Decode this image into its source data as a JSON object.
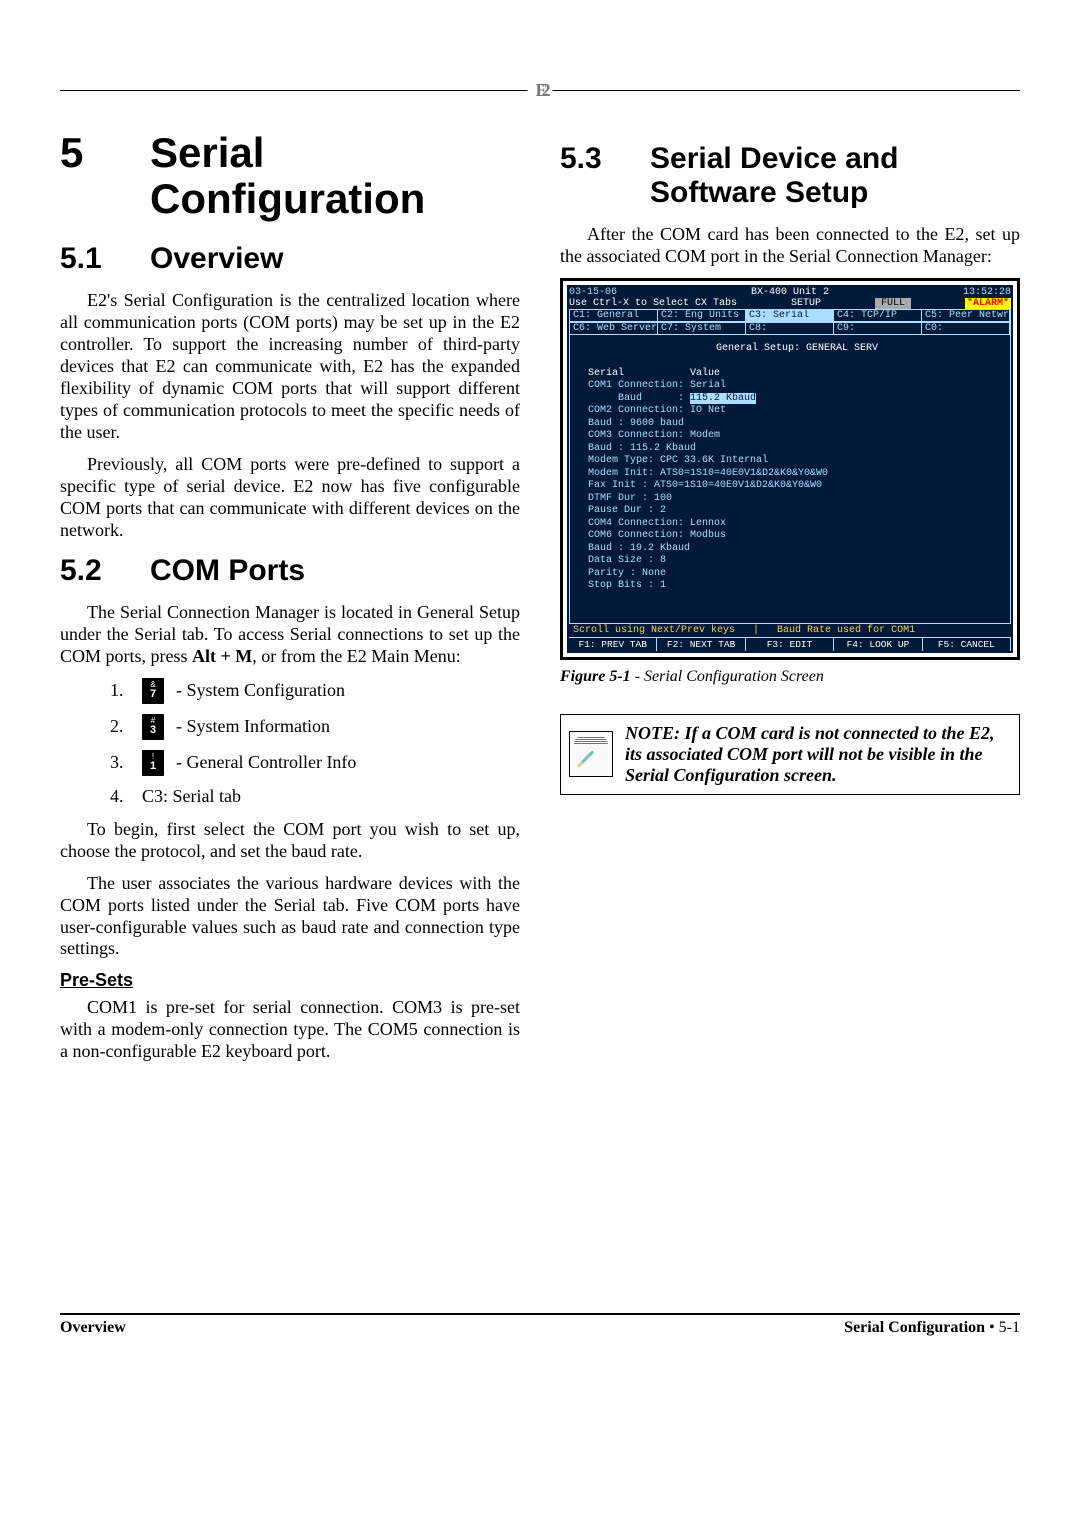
{
  "logo_text": "E2",
  "left": {
    "chapter": {
      "num": "5",
      "title": "Serial Configuration"
    },
    "s1": {
      "num": "5.1",
      "title": "Overview",
      "p1": "E2's Serial Configuration is the centralized location where all communication ports (COM ports) may be set up in the E2 controller. To support the increasing number of third-party devices that E2 can communicate with, E2 has the expanded flexibility of dynamic COM ports that will support different types of communication protocols to meet the specific needs of the user.",
      "p2": "Previously, all COM ports were pre-defined to support a specific type of serial device. E2 now has five configurable COM ports that can communicate with different devices on the network."
    },
    "s2": {
      "num": "5.2",
      "title": "COM Ports",
      "p1_a": "The Serial Connection Manager is located in General Setup under the Serial tab. To access Serial connections to set up the COM ports, press ",
      "p1_b": "Alt + M",
      "p1_c": ", or from the E2 Main Menu:",
      "steps": [
        {
          "n": "1.",
          "key_top": "&",
          "key_bot": "7",
          "label": " - System Configuration"
        },
        {
          "n": "2.",
          "key_top": "#",
          "key_bot": "3",
          "label": " - System Information"
        },
        {
          "n": "3.",
          "key_top": "!",
          "key_bot": "1",
          "label": " - General Controller Info"
        },
        {
          "n": "4.",
          "label": "C3: Serial tab"
        }
      ],
      "p2": "To begin, first select the COM port you wish to set up, choose the protocol, and set the baud rate.",
      "p3": "The user associates the various hardware devices with the COM ports listed under the Serial tab. Five COM ports have user-configurable values such as baud rate and connection type settings.",
      "presets_h": "Pre-Sets",
      "p4": "COM1 is pre-set for serial connection. COM3 is pre-set with a modem-only connection type. The COM5 connection is a non-configurable E2 keyboard port."
    }
  },
  "right": {
    "s3": {
      "num": "5.3",
      "title": "Serial Device and Software Setup",
      "p1": "After the COM card has been connected to the E2, set up the associated COM port in the Serial Connection Manager:"
    },
    "screenshot": {
      "date": "03-15-06",
      "unit": "BX-400 Unit 2",
      "time": "13:52:28",
      "hint": "Use Ctrl-X to Select CX Tabs",
      "mode": "SETUP",
      "full": "FULL",
      "alarm": "*ALARM*",
      "tabs_row1": [
        "C1: General",
        "C2: Eng Units",
        "C3: Serial",
        "C4: TCP/IP",
        "C5: Peer Netwrk"
      ],
      "tabs_row2": [
        "C6: Web Server",
        "C7: System",
        "C8:",
        "C9:",
        "C0:"
      ],
      "panel_title": "General Setup: GENERAL SERV",
      "cols": {
        "left": "Serial",
        "right": "Value"
      },
      "rows": [
        "COM1 Connection: Serial",
        "     Baud      : 115.2 Kbaud",
        "COM2 Connection: IO Net",
        "     Baud      : 9600 baud",
        "COM3 Connection: Modem",
        "     Baud      : 115.2 Kbaud",
        "     Modem Type: CPC 33.6K Internal",
        "     Modem Init: ATS0=1S10=40E0V1&D2&K0&Y0&W0",
        "     Fax Init  : ATS0=1S10=40E0V1&D2&K0&Y0&W0",
        "     DTMF Dur  :    100",
        "     Pause Dur :      2",
        "COM4 Connection: Lennox",
        "COM6 Connection: Modbus",
        "     Baud      : 19.2 Kbaud",
        "     Data Size :      8",
        "     Parity    : None",
        "     Stop Bits :      1"
      ],
      "status_left": "Scroll using Next/Prev keys",
      "status_right": "Baud Rate used for COM1",
      "fkeys": [
        "F1: PREV TAB",
        "F2: NEXT TAB",
        "F3: EDIT",
        "F4: LOOK UP",
        "F5: CANCEL"
      ]
    },
    "caption": {
      "bold": "Figure 5-1",
      "rest": " - Serial Configuration Screen"
    },
    "note": "NOTE: If a COM card is not connected to the E2, its associated COM port will not be visible in the Serial Configuration screen."
  },
  "footer": {
    "left": "Overview",
    "right_title": "Serial Configuration",
    "right_page": " • 5-1"
  }
}
